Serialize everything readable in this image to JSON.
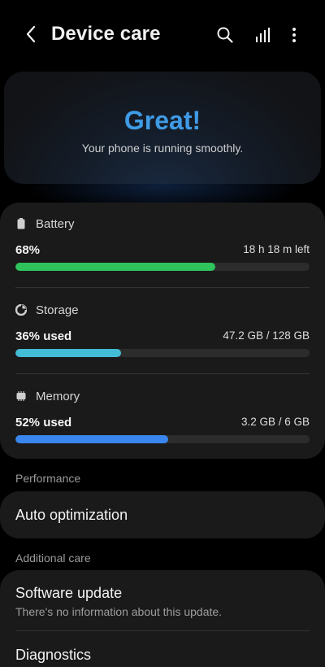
{
  "header": {
    "title": "Device care",
    "icons": [
      "back-arrow-icon",
      "search-icon",
      "stats-icon",
      "more-vertical-icon"
    ]
  },
  "status": {
    "headline": "Great!",
    "message": "Your phone is running smoothly.",
    "headline_color": "#3f9be6"
  },
  "metrics": {
    "battery": {
      "label": "Battery",
      "value": "68%",
      "detail": "18 h 18 m left",
      "level": 0.68,
      "color": "#2fc35c",
      "icon": "battery-icon"
    },
    "storage": {
      "label": "Storage",
      "value": "36% used",
      "detail": "47.2 GB / 128 GB",
      "level": 0.36,
      "color": "#43bcd6",
      "icon": "pie-chart-icon"
    },
    "memory": {
      "label": "Memory",
      "value": "52% used",
      "detail": "3.2 GB / 6 GB",
      "level": 0.52,
      "color": "#3a86ee",
      "icon": "memory-chip-icon"
    }
  },
  "sections": {
    "performance": {
      "label": "Performance",
      "items": [
        {
          "title": "Auto optimization"
        }
      ]
    },
    "additional_care": {
      "label": "Additional care",
      "items": [
        {
          "title": "Software update",
          "subtitle": "There's no information about this update."
        },
        {
          "title": "Diagnostics"
        }
      ]
    }
  }
}
